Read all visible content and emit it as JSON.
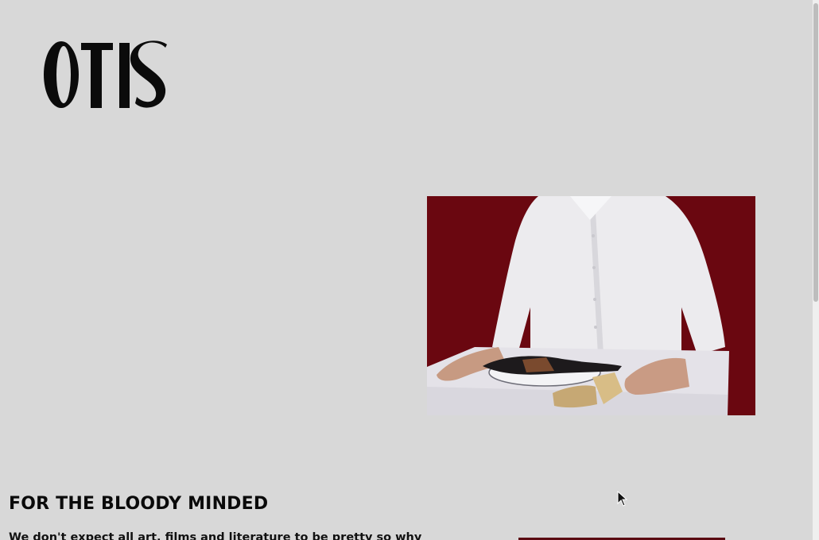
{
  "brand": {
    "logo_text": "OTIS"
  },
  "hero": {
    "image_icon": "photo-man-with-sardines",
    "background_color": "#6a0710"
  },
  "section": {
    "headline": "FOR THE BLOODY MINDED",
    "body_partial": "We don't expect all art, films and literature to be pretty so why"
  },
  "colors": {
    "page_background": "#d8d8d8",
    "accent_dark_red": "#6a0710",
    "text": "#0a0a0a"
  }
}
